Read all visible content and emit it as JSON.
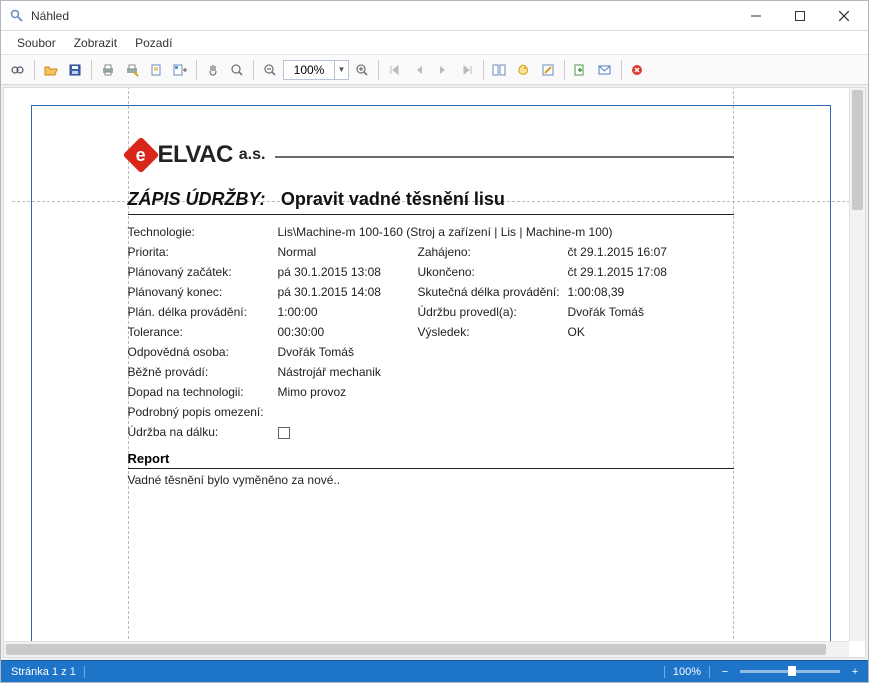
{
  "window": {
    "title": "Náhled"
  },
  "menu": {
    "file": "Soubor",
    "view": "Zobrazit",
    "background": "Pozadí"
  },
  "toolbar": {
    "zoom_value": "100%"
  },
  "doc": {
    "logo": {
      "brand": "ELVAC",
      "suffix": "a.s."
    },
    "title_prefix": "ZÁPIS ÚDRŽBY:",
    "title_action": "Opravit vadné těsnění lisu",
    "rows": {
      "technologie_lbl": "Technologie:",
      "technologie_val": "Lis\\Machine-m 100-160 (Stroj a zařízení | Lis | Machine-m 100)",
      "priorita_lbl": "Priorita:",
      "priorita_val": "Normal",
      "zahajeno_lbl": "Zahájeno:",
      "zahajeno_val": "čt 29.1.2015 16:07",
      "plan_zacatek_lbl": "Plánovaný začátek:",
      "plan_zacatek_val": "pá 30.1.2015 13:08",
      "ukonceno_lbl": "Ukončeno:",
      "ukonceno_val": "čt 29.1.2015 17:08",
      "plan_konec_lbl": "Plánovaný konec:",
      "plan_konec_val": "pá 30.1.2015 14:08",
      "skut_delka_lbl": "Skutečná délka provádění:",
      "skut_delka_val": "1:00:08,39",
      "plan_delka_lbl": "Plán. délka provádění:",
      "plan_delka_val": "1:00:00",
      "provedl_lbl": "Údržbu provedl(a):",
      "provedl_val": "Dvořák Tomáš",
      "tolerance_lbl": "Tolerance:",
      "tolerance_val": "00:30:00",
      "vysledek_lbl": "Výsledek:",
      "vysledek_val": "OK",
      "odpovedna_lbl": "Odpovědná osoba:",
      "odpovedna_val": "Dvořák Tomáš",
      "bezne_lbl": "Běžně provádí:",
      "bezne_val": "Nástrojář mechanik",
      "dopad_lbl": "Dopad na technologii:",
      "dopad_val": "Mimo provoz",
      "popis_lbl": "Podrobný popis omezení:",
      "popis_val": "",
      "dalku_lbl": "Údržba na dálku:"
    },
    "report": {
      "heading": "Report",
      "body": "Vadné těsnění bylo vyměněno za nové.."
    }
  },
  "statusbar": {
    "page": "Stránka 1 z 1",
    "zoom": "100%"
  }
}
